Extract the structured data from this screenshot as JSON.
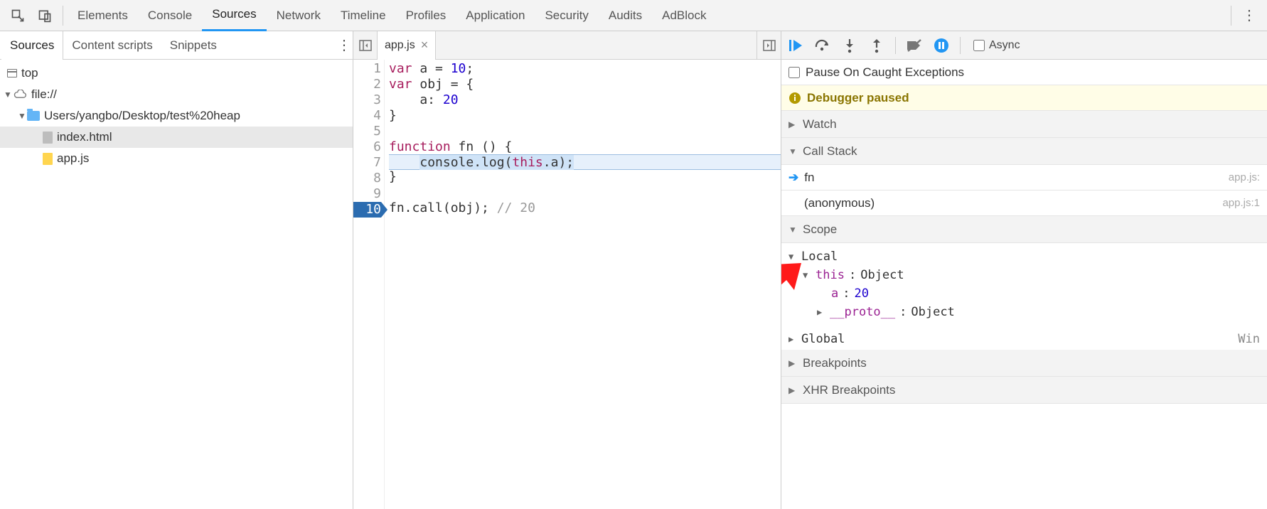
{
  "mainTabs": {
    "elements": "Elements",
    "console": "Console",
    "sources": "Sources",
    "network": "Network",
    "timeline": "Timeline",
    "profiles": "Profiles",
    "application": "Application",
    "security": "Security",
    "audits": "Audits",
    "adblock": "AdBlock"
  },
  "navTabs": {
    "sources": "Sources",
    "contentScripts": "Content scripts",
    "snippets": "Snippets"
  },
  "tree": {
    "top": "top",
    "file": "file://",
    "folder": "Users/yangbo/Desktop/test%20heap",
    "indexHtml": "index.html",
    "appJs": "app.js"
  },
  "editor": {
    "tabName": "app.js",
    "lines": {
      "l1": "var a = 10;",
      "l2": "var obj = {",
      "l3": "    a: 20",
      "l4": "}",
      "l5": "",
      "l6": "function fn () {",
      "l7": "    console.log(this.a);",
      "l8": "}",
      "l9": "",
      "l10": "fn.call(obj); // 20"
    },
    "nums": {
      "n1": "1",
      "n2": "2",
      "n3": "3",
      "n4": "4",
      "n5": "5",
      "n6": "6",
      "n7": "7",
      "n8": "8",
      "n9": "9",
      "n10": "10"
    }
  },
  "debug": {
    "asyncLabel": "Async",
    "pauseOnCaught": "Pause On Caught Exceptions",
    "paused": "Debugger paused",
    "watch": "Watch",
    "callStack": "Call Stack",
    "frame1": "fn",
    "frame1loc": "app.js:",
    "frame2": "(anonymous)",
    "frame2loc": "app.js:1",
    "scope": "Scope",
    "local": "Local",
    "thisLabel": "this",
    "thisVal": "Object",
    "aLabel": "a",
    "aVal": "20",
    "protoLabel": "__proto__",
    "protoVal": "Object",
    "global": "Global",
    "globalVal": "Win",
    "breakpoints": "Breakpoints",
    "xhrBreakpoints": "XHR Breakpoints"
  }
}
